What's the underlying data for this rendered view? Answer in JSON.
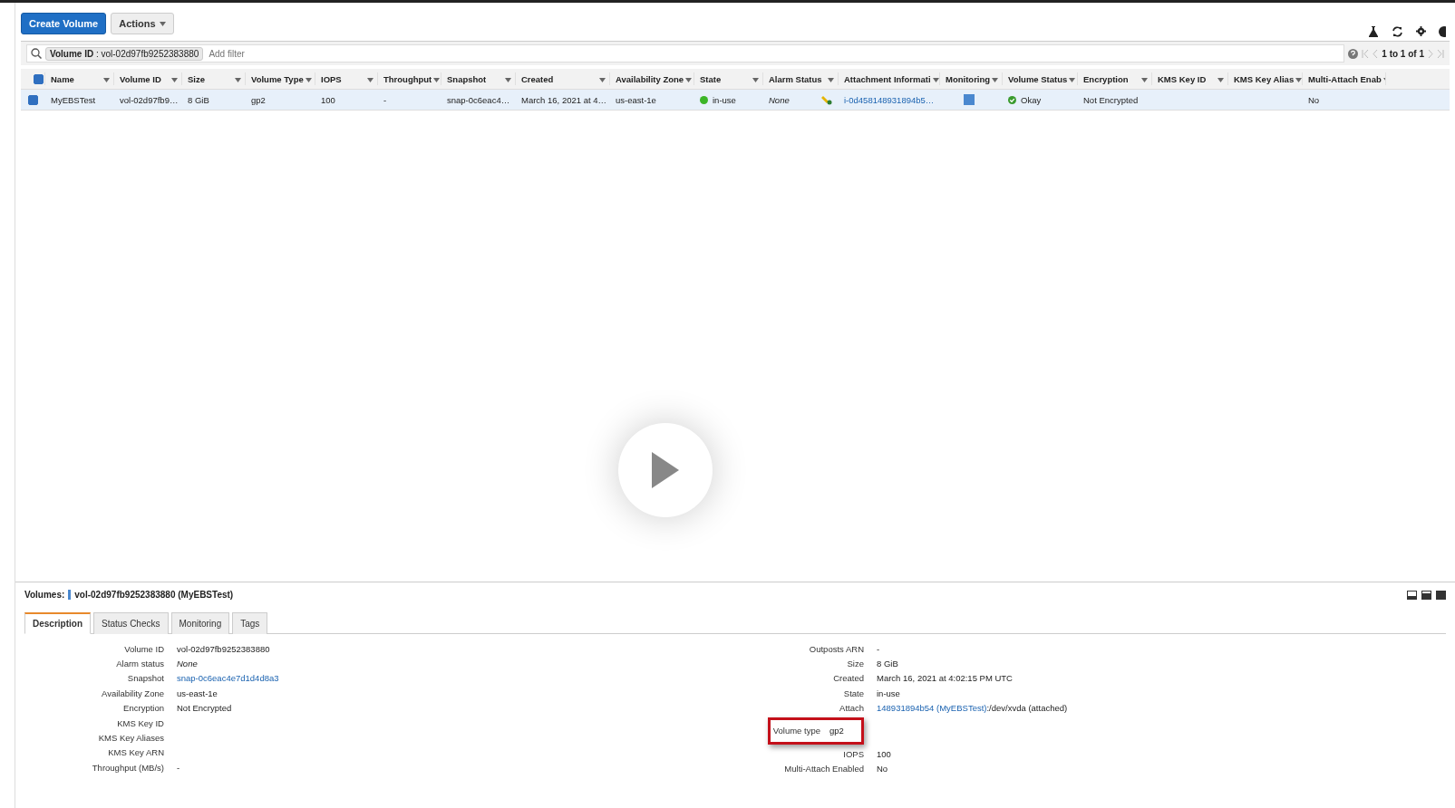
{
  "toolbar": {
    "create_button": "Create Volume",
    "actions_button": "Actions"
  },
  "select_all_checked": true,
  "filter": {
    "token": "**Volume ID** : vol-02d97fb9252383880",
    "placeholder": "Add filter",
    "pagination": "1 to 1 of 1"
  },
  "table": {
    "columns": [
      {
        "label": "Name"
      },
      {
        "label": "Volume ID"
      },
      {
        "label": "Size"
      },
      {
        "label": "Volume Type"
      },
      {
        "label": "IOPS"
      },
      {
        "label": "Throughput"
      },
      {
        "label": "Snapshot"
      },
      {
        "label": "Created"
      },
      {
        "label": "Availability Zone"
      },
      {
        "label": "State"
      },
      {
        "label": "Alarm Status"
      },
      {
        "label": "Attachment Informati"
      },
      {
        "label": "Monitoring"
      },
      {
        "label": "Volume Status"
      },
      {
        "label": "Encryption"
      },
      {
        "label": "KMS Key ID"
      },
      {
        "label": "KMS Key Alias"
      },
      {
        "label": "Multi-Attach Enab"
      }
    ],
    "rows": [
      {
        "selected": true,
        "cells": [
          {
            "kind": "text",
            "text": "MyEBSTest"
          },
          {
            "kind": "text",
            "text": "vol-02d97fb9…"
          },
          {
            "kind": "text",
            "text": "8 GiB"
          },
          {
            "kind": "text",
            "text": "gp2"
          },
          {
            "kind": "text",
            "text": "100"
          },
          {
            "kind": "text",
            "text": "-"
          },
          {
            "kind": "text",
            "text": "snap-0c6eac4…"
          },
          {
            "kind": "text",
            "text": "March 16, 2021 at 4…"
          },
          {
            "kind": "text",
            "text": "us-east-1e"
          },
          {
            "kind": "status",
            "text": "in-use",
            "color": "#3cb528"
          },
          {
            "kind": "alarm",
            "text": "None"
          },
          {
            "kind": "link",
            "text": "i-0d458148931894b5…"
          },
          {
            "kind": "monitor"
          },
          {
            "kind": "okay",
            "text": "Okay"
          },
          {
            "kind": "text",
            "text": "Not Encrypted"
          },
          {
            "kind": "empty"
          },
          {
            "kind": "empty"
          },
          {
            "kind": "text",
            "text": "No"
          }
        ]
      }
    ]
  },
  "details": {
    "heading_label": "Volumes:",
    "heading_value": "vol-02d97fb9252383880 (MyEBSTest)",
    "tabs": [
      {
        "label": "Description",
        "selected": true
      },
      {
        "label": "Status Checks",
        "selected": false
      },
      {
        "label": "Monitoring",
        "selected": false
      },
      {
        "label": "Tags",
        "selected": false
      }
    ],
    "left": [
      {
        "label": "Volume ID",
        "value": "vol-02d97fb9252383880",
        "kind": "text"
      },
      {
        "label": "Alarm status",
        "value": "None",
        "kind": "italic"
      },
      {
        "label": "Snapshot",
        "value": "snap-0c6eac4e7d1d4d8a3",
        "kind": "link"
      },
      {
        "label": "Availability Zone",
        "value": "us-east-1e",
        "kind": "text"
      },
      {
        "label": "Encryption",
        "value": "Not Encrypted",
        "kind": "text"
      },
      {
        "label": "KMS Key ID"
      },
      {
        "label": "KMS Key Aliases"
      },
      {
        "label": "KMS Key ARN"
      },
      {
        "label": "Throughput (MB/s)",
        "value": "-",
        "kind": "text"
      }
    ],
    "right": [
      {
        "label": "Outposts ARN",
        "value": "-",
        "kind": "text",
        "highlighted": false
      },
      {
        "label": "Size",
        "value": "8 GiB",
        "kind": "text",
        "highlighted": false
      },
      {
        "label": "Created",
        "value": "March 16, 2021 at 4:02:15 PM UTC",
        "kind": "text",
        "highlighted": false
      },
      {
        "label": "State",
        "value": "in-use",
        "kind": "text",
        "highlighted": false
      },
      {
        "label": "Attach",
        "value": "148931894b54 (MyEBSTest)",
        "suffix": ":/dev/xvda (attached)",
        "kind": "link",
        "highlighted": false
      },
      {
        "label": "Volume type",
        "value": "gp2",
        "kind": "text",
        "highlighted": true
      },
      {
        "label": "IOPS",
        "value": "100",
        "kind": "text",
        "highlighted": false
      },
      {
        "label": "Multi-Attach Enabled",
        "value": "No",
        "kind": "text",
        "highlighted": false
      }
    ]
  }
}
